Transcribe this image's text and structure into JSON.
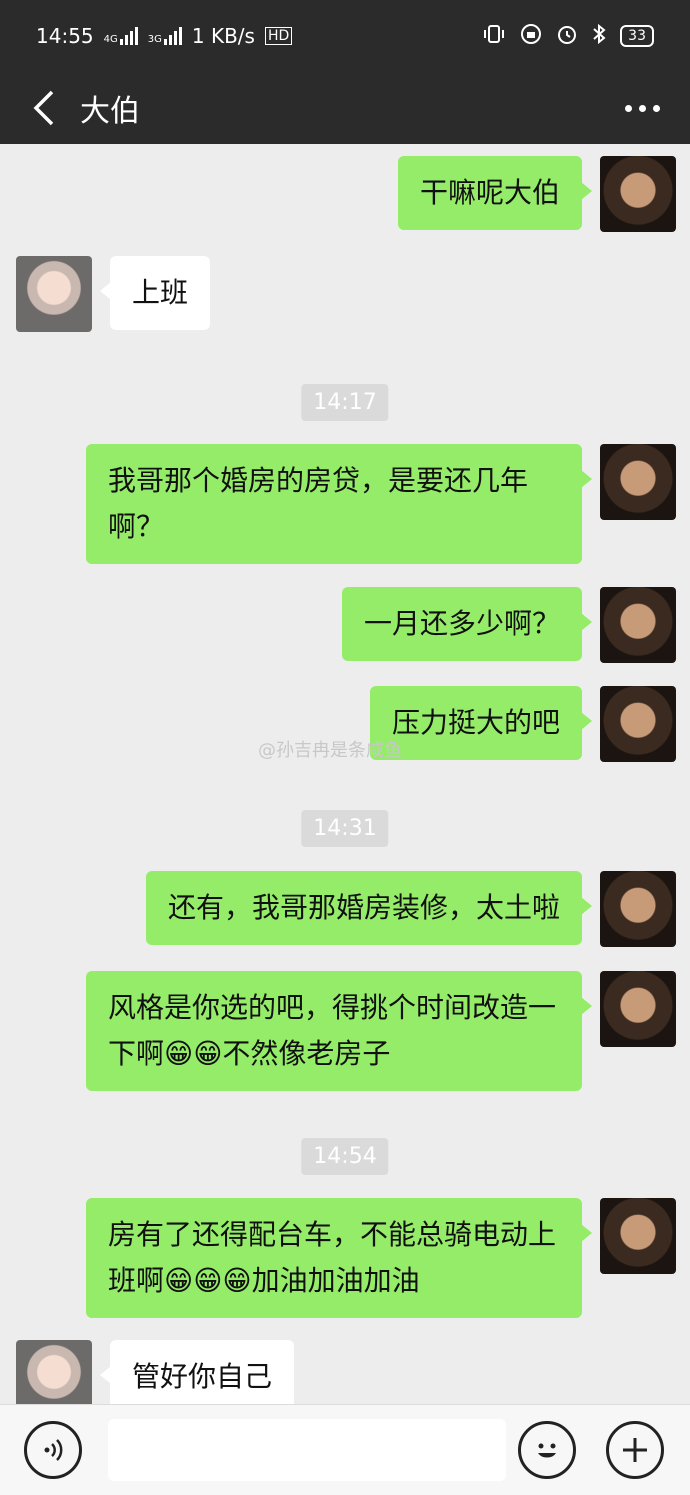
{
  "status_bar": {
    "time": "14:55",
    "net_4g": "4G",
    "net_3g": "3G",
    "speed": "1 KB/s",
    "hd": "HD",
    "battery": "33"
  },
  "header": {
    "title": "大伯"
  },
  "messages": [
    {
      "text": "干嘛呢大伯"
    },
    {
      "text": "上班"
    },
    {
      "time": "14:17"
    },
    {
      "text": "我哥那个婚房的房贷，是要还几年啊？"
    },
    {
      "text": "一月还多少啊？"
    },
    {
      "text": "压力挺大的吧"
    },
    {
      "time": "14:31"
    },
    {
      "text": "还有，我哥那婚房装修，太土啦"
    },
    {
      "text": "风格是你选的吧，得挑个时间改造一下啊😁😁不然像老房子"
    },
    {
      "time": "14:54"
    },
    {
      "text": "房有了还得配台车，不能总骑电动上班啊😁😁😁加油加油加油"
    },
    {
      "text": "管好你自己"
    }
  ],
  "watermark": "@孙吉冉是条咸鱼",
  "input_bar": {
    "voice": "voice-icon",
    "emoji": "emoji-icon",
    "plus": "plus-icon"
  }
}
